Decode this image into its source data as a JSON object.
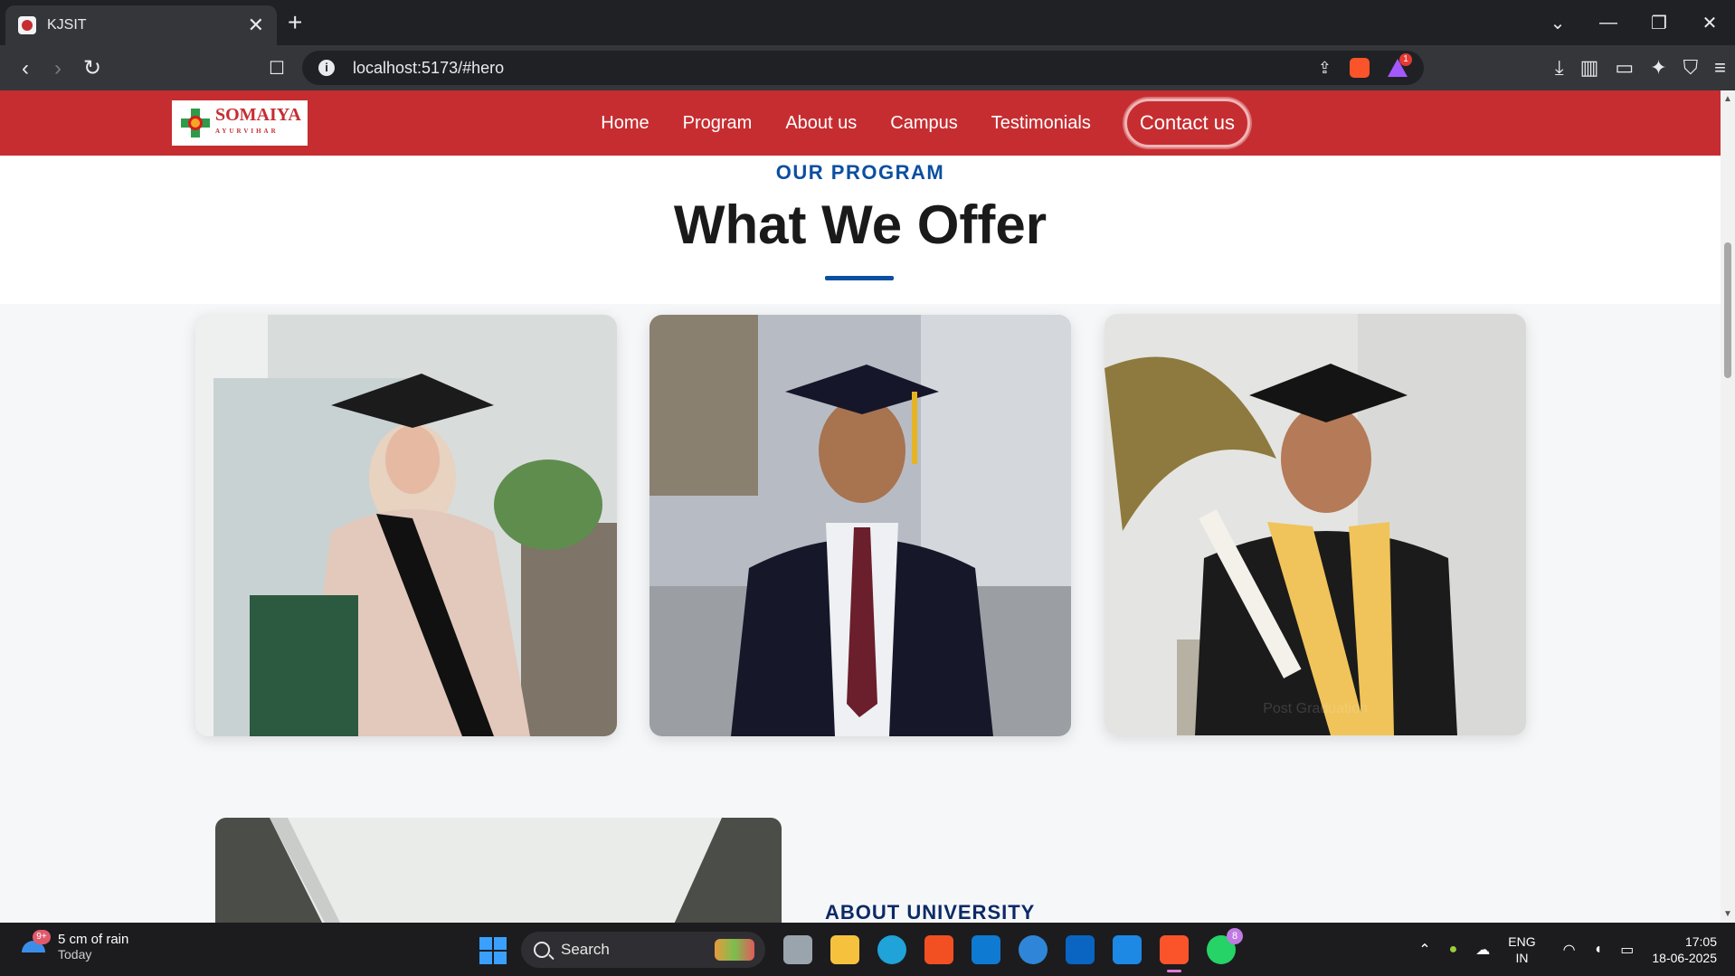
{
  "browser": {
    "tab_title": "KJSIT",
    "tab_close": "✕",
    "new_tab": "+",
    "url": "localhost:5173/#hero",
    "brave_badge": "1",
    "window_controls": [
      "⌄",
      "—",
      "❐",
      "✕"
    ]
  },
  "site": {
    "logo_text": "SOMAIYA",
    "logo_subtext": "AYURVIHAR",
    "nav": [
      "Home",
      "Program",
      "About us",
      "Campus",
      "Testimonials"
    ],
    "contact_label": "Contact us",
    "accent_color": "#c62d31"
  },
  "program": {
    "kicker": "OUR PROGRAM",
    "heading": "What We Offer",
    "cards": [
      {
        "label": ""
      },
      {
        "label": ""
      },
      {
        "label": "Post Graduation"
      }
    ],
    "underline_color": "#0b4fa0"
  },
  "about": {
    "kicker": "ABOUT UNIVERSITY"
  },
  "taskbar": {
    "weather_title": "5 cm of rain",
    "weather_sub": "Today",
    "weather_badge": "9+",
    "search_label": "Search",
    "whatsapp_badge": "8",
    "lang_top": "ENG",
    "lang_bottom": "IN",
    "time": "17:05",
    "date": "18-06-2025"
  }
}
